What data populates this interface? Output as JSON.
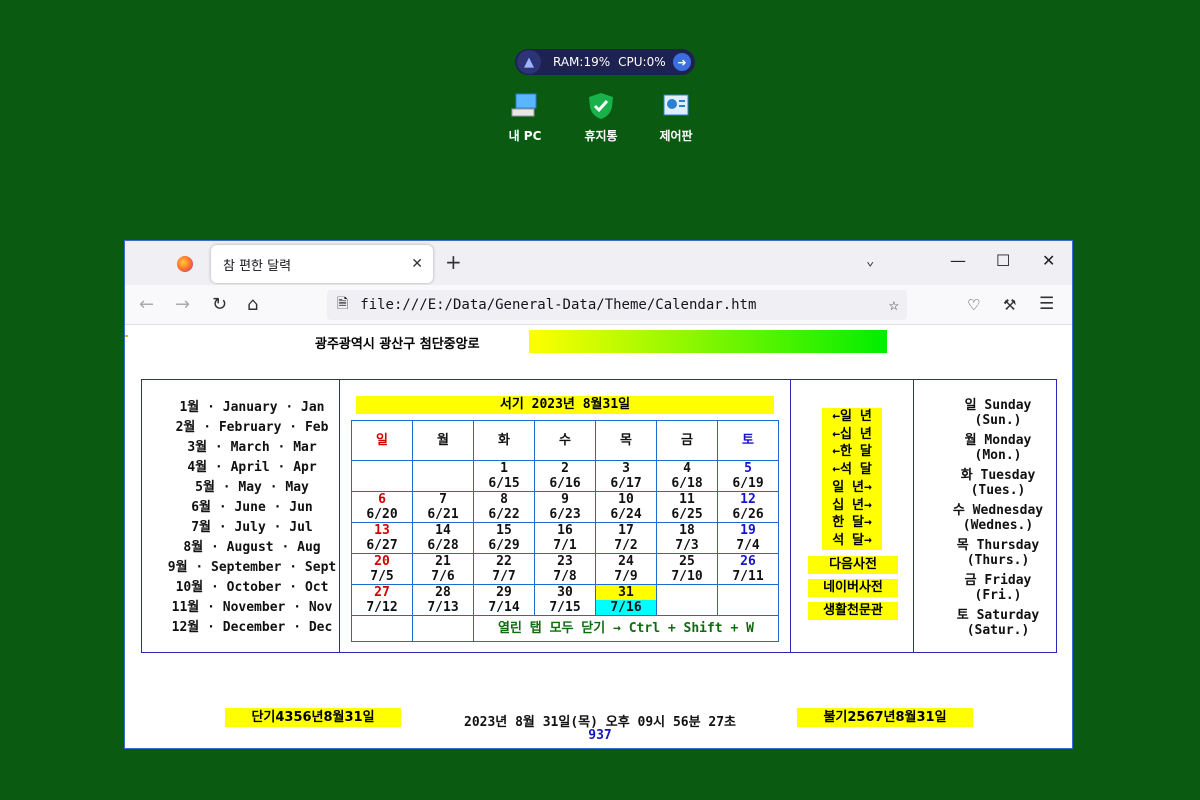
{
  "desktop": {
    "sysmon": {
      "ram": "RAM:19%",
      "cpu": "CPU:0%"
    },
    "icons": [
      {
        "label": "내 PC"
      },
      {
        "label": "휴지통"
      },
      {
        "label": "제어판"
      }
    ]
  },
  "browser": {
    "tab_title": "참 편한 달력",
    "url": "file:///E:/Data/General-Data/Theme/Calendar.htm"
  },
  "page": {
    "location": "광주광역시 광산구 첨단중앙로",
    "months": [
      "1월 · January · Jan",
      "2월 · February · Feb",
      "3월 · March · Mar",
      "4월 · April · Apr",
      "5월 ·  May · May",
      "6월 · June · Jun",
      "7월 · July · Jul",
      "8월 · August · Aug",
      "9월 · September · Sept",
      "10월 · October · Oct",
      "11월 · November · Nov",
      "12월 · December · Dec"
    ],
    "current_date": "서기 2023년 8월31일",
    "weekday_headers": [
      "일",
      "월",
      "화",
      "수",
      "목",
      "금",
      "토"
    ],
    "weeks": [
      [
        [
          "",
          ""
        ],
        [
          "",
          ""
        ],
        [
          "1",
          "6/15"
        ],
        [
          "2",
          "6/16"
        ],
        [
          "3",
          "6/17"
        ],
        [
          "4",
          "6/18"
        ],
        [
          "5",
          "6/19"
        ]
      ],
      [
        [
          "6",
          "6/20"
        ],
        [
          "7",
          "6/21"
        ],
        [
          "8",
          "6/22"
        ],
        [
          "9",
          "6/23"
        ],
        [
          "10",
          "6/24"
        ],
        [
          "11",
          "6/25"
        ],
        [
          "12",
          "6/26"
        ]
      ],
      [
        [
          "13",
          "6/27"
        ],
        [
          "14",
          "6/28"
        ],
        [
          "15",
          "6/29"
        ],
        [
          "16",
          "7/1"
        ],
        [
          "17",
          "7/2"
        ],
        [
          "18",
          "7/3"
        ],
        [
          "19",
          "7/4"
        ]
      ],
      [
        [
          "20",
          "7/5"
        ],
        [
          "21",
          "7/6"
        ],
        [
          "22",
          "7/7"
        ],
        [
          "23",
          "7/8"
        ],
        [
          "24",
          "7/9"
        ],
        [
          "25",
          "7/10"
        ],
        [
          "26",
          "7/11"
        ]
      ],
      [
        [
          "27",
          "7/12"
        ],
        [
          "28",
          "7/13"
        ],
        [
          "29",
          "7/14"
        ],
        [
          "30",
          "7/15"
        ],
        [
          "31",
          "7/16"
        ],
        [
          "",
          ""
        ],
        [
          "",
          ""
        ]
      ]
    ],
    "close_hint": "열린 탭 모두 닫기 → Ctrl + Shift + W",
    "nav_buttons": [
      "←일 년",
      "←십 년",
      "←한 달",
      "←석 달",
      "일 년→",
      "십 년→",
      "한 달→",
      "석 달→"
    ],
    "links": [
      "다음사전",
      "네이버사전",
      "생활천문관"
    ],
    "weekdays": [
      [
        "일 Sunday",
        "(Sun.)"
      ],
      [
        "월 Monday",
        "(Mon.)"
      ],
      [
        "화 Tuesday",
        "(Tues.)"
      ],
      [
        "수 Wednesday",
        "(Wednes.)"
      ],
      [
        "목 Thursday",
        "(Thurs.)"
      ],
      [
        "금 Friday",
        "(Fri.)"
      ],
      [
        "토 Saturday",
        "(Satur.)"
      ]
    ],
    "dangi": "단기4356년8월31일",
    "buddhist": "불기2567년8월31일",
    "clock": "2023년 8월 31일(목) 오후 09시 56분 27초",
    "counter": "937"
  }
}
